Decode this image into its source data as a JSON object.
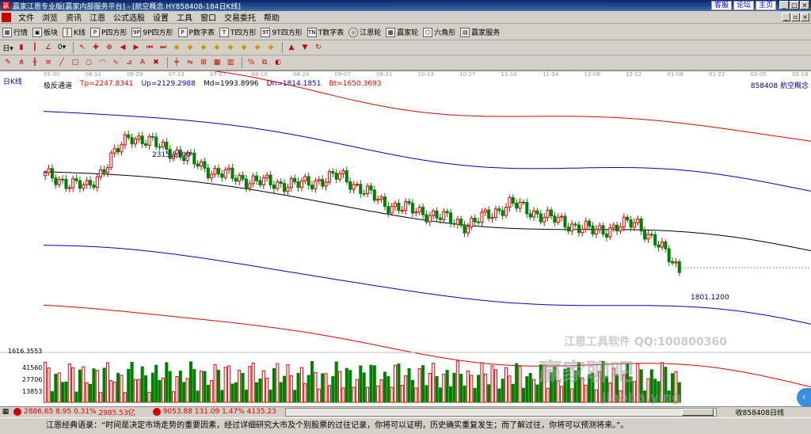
{
  "window": {
    "title": "赢家江恩专业版[赢家内部服务平台] - [航空概念  HY858408-184日K线]",
    "top_links": [
      "客服",
      "论坛",
      "主页"
    ]
  },
  "menu": [
    "文件",
    "浏览",
    "资讯",
    "江恩",
    "公式选股",
    "设置",
    "工具",
    "窗口",
    "交易委托",
    "帮助"
  ],
  "toolbar1": [
    {
      "label": "行情",
      "icon": "grid-icon"
    },
    {
      "label": "板块",
      "icon": "blocks-icon"
    },
    {
      "label": "K线",
      "icon": "candle-icon"
    },
    {
      "label": "P四方形",
      "icon": "p-icon"
    },
    {
      "label": "9P四方形",
      "icon": "9p-icon"
    },
    {
      "label": "P数字表",
      "icon": "p-table-icon"
    },
    {
      "label": "T四方形",
      "icon": "t-icon"
    },
    {
      "label": "9T四方形",
      "icon": "9t-icon"
    },
    {
      "label": "T数字表",
      "icon": "t-table-icon"
    },
    {
      "label": "江恩轮",
      "icon": "wheel-icon"
    },
    {
      "label": "赢家轮",
      "icon": "wheel2-icon"
    },
    {
      "label": "六角形",
      "icon": "hexagon-icon"
    },
    {
      "label": "赢家服务",
      "icon": "service-icon"
    }
  ],
  "chart_header": {
    "period": "日K线",
    "indicator_name": "极反通道",
    "tp": "Tp=2247.8341",
    "up": "Up=2129.2988",
    "md": "Md=1993.8996",
    "dn": "Dn=1814.1851",
    "bt": "Bt=1650.3693",
    "stock": "858408  航空概念"
  },
  "dates": [
    "05-30",
    "06-13",
    "06-29",
    "07-13",
    "07-27",
    "08-10",
    "08-24",
    "09-07",
    "09-21",
    "10-13",
    "10-27",
    "11-10",
    "11-24",
    "12-08",
    "12-22",
    "01-08",
    "01-22",
    "02-05",
    "02-19"
  ],
  "annotations": {
    "high": "2315.2100",
    "low": "1801.1200"
  },
  "volume_axis": [
    "1616.3553",
    "41560",
    "27706",
    "13853"
  ],
  "watermarks": {
    "line1": "江恩工具软件  QQ:100800360",
    "line2": "赢家聊吧",
    "line3": "jiaoba.ying"
  },
  "status": {
    "sh": {
      "value": "2886.65",
      "change": "8.95",
      "pct": "0.31%",
      "amount": "2985.53亿"
    },
    "sz": {
      "value": "9053.88",
      "change": "131.09",
      "pct": "1.47%",
      "amount": "4135.23"
    },
    "right": "收858408日线"
  },
  "quote": "江恩经典语录：“时间是决定市场走势的重要因素，经过详细研究大市及个别股票的过往记录，你将可以证明，历史确实重复发生；而了解过往，你将可以预测将来。”。",
  "chart_data": {
    "type": "candlestick",
    "title": "航空概念 日K线",
    "x": [
      "05-30",
      "06-13",
      "06-29",
      "07-13",
      "07-27",
      "08-10",
      "08-24",
      "09-07",
      "09-21",
      "10-13",
      "10-27",
      "11-10",
      "11-24",
      "12-08",
      "12-22",
      "01-08"
    ],
    "close": [
      2110,
      2070,
      2240,
      2190,
      2120,
      2090,
      2080,
      2110,
      2020,
      1990,
      1950,
      2020,
      1970,
      1930,
      1960,
      1810
    ],
    "channel": {
      "tp": 2247.8341,
      "up": 2129.2988,
      "md": 1993.8996,
      "dn": 1814.1851,
      "bt": 1650.3693
    },
    "high_marker": 2315.21,
    "low_marker": 1801.12,
    "colors": {
      "up": "#e00000",
      "down": "#008000",
      "tp_bt": "#e00000",
      "up_dn": "#0000c0",
      "md": "#000000"
    }
  }
}
